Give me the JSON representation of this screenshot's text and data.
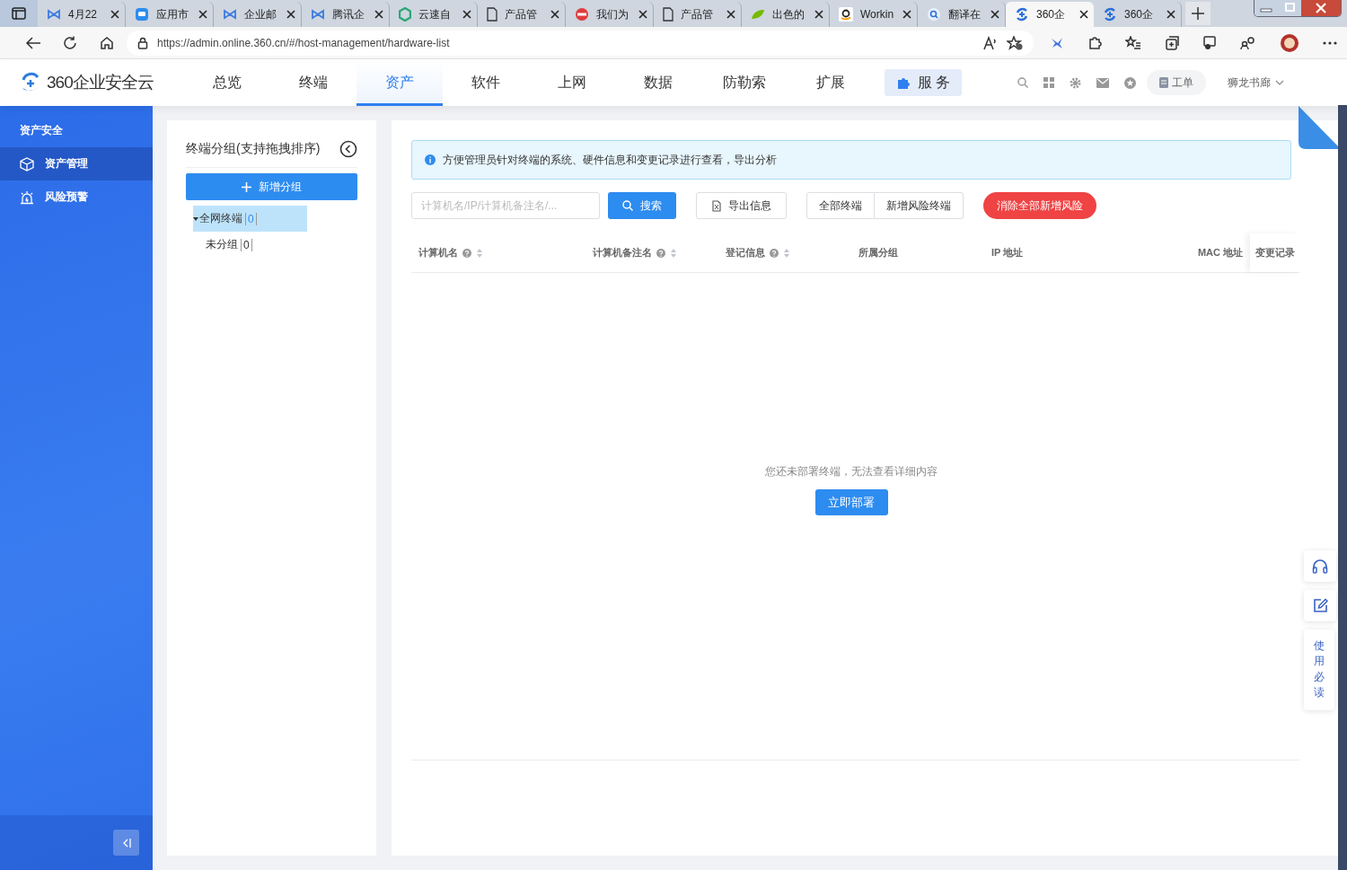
{
  "browser": {
    "tabs": [
      {
        "title": "4月22",
        "kind": "bowtie",
        "selected": false
      },
      {
        "title": "应用市",
        "kind": "chat",
        "selected": false
      },
      {
        "title": "企业邮",
        "kind": "bowtie",
        "selected": false
      },
      {
        "title": "腾讯企",
        "kind": "bowtie",
        "selected": false
      },
      {
        "title": "云速自",
        "kind": "hexagon",
        "selected": false
      },
      {
        "title": "产品管",
        "kind": "page",
        "selected": false
      },
      {
        "title": "我们为",
        "kind": "stop",
        "selected": false
      },
      {
        "title": "产品管",
        "kind": "page",
        "selected": false
      },
      {
        "title": "出色的",
        "kind": "leaf",
        "selected": false
      },
      {
        "title": "Workin",
        "kind": "smile",
        "selected": false
      },
      {
        "title": "翻译在",
        "kind": "magnifier",
        "selected": false
      },
      {
        "title": "360企",
        "kind": "swirl",
        "selected": true
      },
      {
        "title": "360企",
        "kind": "swirl",
        "selected": false
      }
    ],
    "url": "https://admin.online.360.cn/#/host-management/hardware-list"
  },
  "header": {
    "logo": "360企业安全云",
    "nav": [
      {
        "label": "总览",
        "selected": false
      },
      {
        "label": "终端",
        "selected": false
      },
      {
        "label": "资产",
        "selected": true
      },
      {
        "label": "软件",
        "selected": false
      },
      {
        "label": "上网",
        "selected": false
      },
      {
        "label": "数据",
        "selected": false
      },
      {
        "label": "防勒索",
        "selected": false
      },
      {
        "label": "扩展",
        "selected": false
      }
    ],
    "service": "服 务",
    "ticket": "工单",
    "user": "狮龙书廊"
  },
  "sidebar": {
    "section": "资产安全",
    "items": [
      {
        "label": "资产管理",
        "kind": "cube",
        "selected": true
      },
      {
        "label": "风险预警",
        "kind": "alarm",
        "selected": false
      }
    ]
  },
  "groups": {
    "title": "终端分组(支持拖拽排序)",
    "add_button": "新增分组",
    "tree": [
      {
        "label": "全网终端",
        "count": "0",
        "selected": true,
        "expanded": true,
        "children": [
          {
            "label": "未分组",
            "count": "0",
            "selected": false
          }
        ]
      }
    ]
  },
  "hosts": {
    "info": "方便管理员针对终端的系统、硬件信息和变更记录进行查看，导出分析",
    "search": {
      "placeholder": "计算机名/IP/计算机备注名/..."
    },
    "search_button": "搜索",
    "export_button": "导出信息",
    "filters": [
      "全部终端",
      "新增风险终端"
    ],
    "clear_button": "消除全部新增风险",
    "table": {
      "columns": [
        {
          "label": "计算机名",
          "help": true,
          "sortable": true
        },
        {
          "label": "计算机备注名",
          "help": true,
          "sortable": true
        },
        {
          "label": "登记信息",
          "help": true,
          "sortable": true
        },
        {
          "label": "所属分组",
          "help": false,
          "sortable": false
        },
        {
          "label": "IP 地址",
          "help": false,
          "sortable": false
        },
        {
          "label": "MAC 地址",
          "help": false,
          "sortable": false
        },
        {
          "label": "变更记录",
          "help": false,
          "sortable": false
        }
      ]
    },
    "empty_text": "您还未部署终端，无法查看详细内容",
    "deploy_button": "立即部署"
  },
  "float_tools": {
    "guide": "使用必读"
  }
}
